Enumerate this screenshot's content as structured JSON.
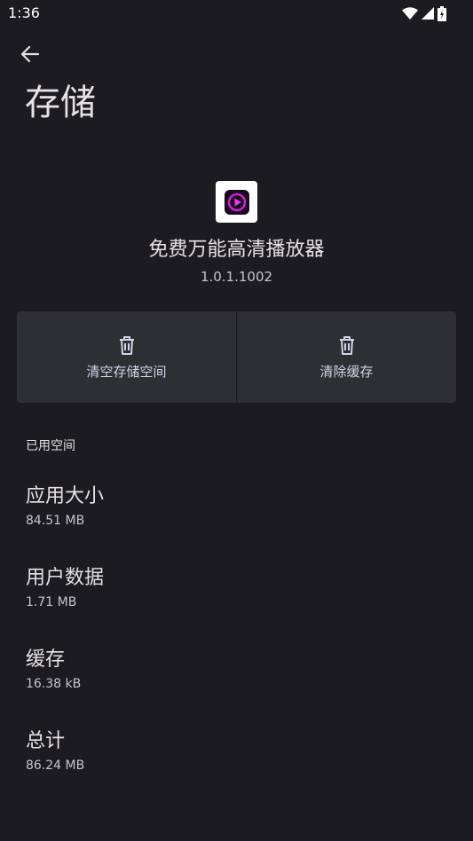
{
  "status_bar": {
    "time": "1:36",
    "icons": [
      "wifi-icon",
      "signal-icon",
      "battery-icon"
    ]
  },
  "header": {
    "back_icon": "arrow-back-icon",
    "title": "存储"
  },
  "app": {
    "icon": "video-player-app-icon",
    "name": "免费万能高清播放器",
    "version": "1.0.1.1002"
  },
  "actions": {
    "clear_storage": {
      "label": "清空存储空间",
      "icon": "trash-icon"
    },
    "clear_cache": {
      "label": "清除缓存",
      "icon": "trash-icon"
    }
  },
  "storage": {
    "section_title": "已用空间",
    "items": [
      {
        "title": "应用大小",
        "value": "84.51 MB"
      },
      {
        "title": "用户数据",
        "value": "1.71 MB"
      },
      {
        "title": "缓存",
        "value": "16.38 kB"
      },
      {
        "title": "总计",
        "value": "86.24 MB"
      }
    ]
  },
  "colors": {
    "background": "#1c1b1f",
    "button_surface": "#2e2f33",
    "app_icon_accent": "#d020d8"
  }
}
